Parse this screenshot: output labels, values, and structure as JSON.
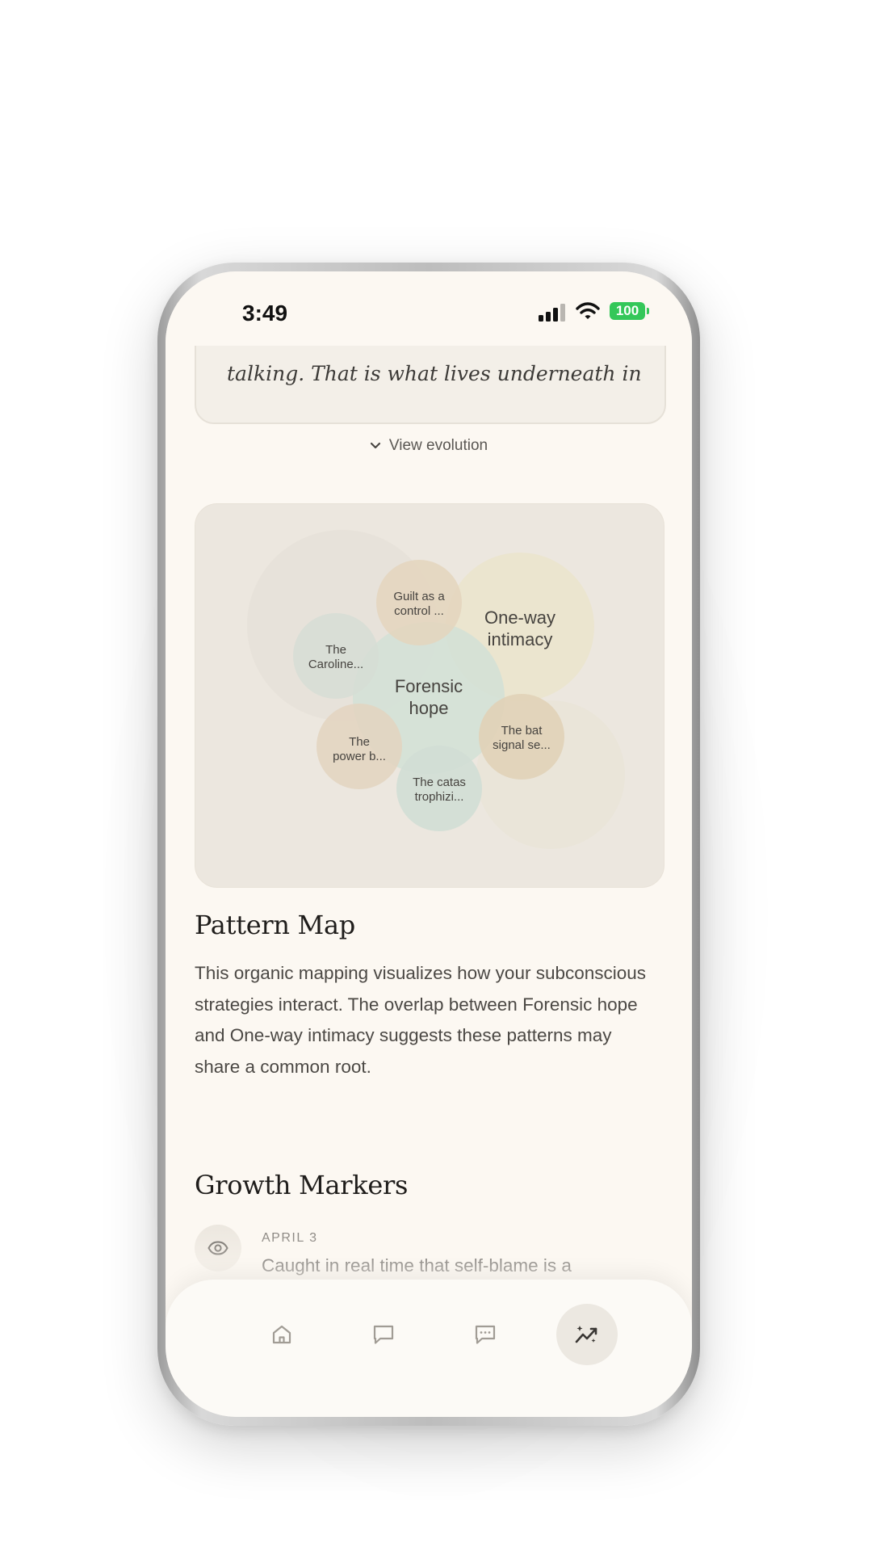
{
  "status_bar": {
    "time": "3:49",
    "battery": "100"
  },
  "insight": {
    "quote_partial": "talking. That is what lives underneath in",
    "view_evolution_label": "View evolution"
  },
  "pattern_map": {
    "bubbles": [
      {
        "id": "forensic-hope",
        "lines": [
          "Forensic",
          "hope"
        ],
        "color": "#cfe0d6",
        "primary": true
      },
      {
        "id": "one-way-intimacy",
        "lines": [
          "One-way",
          "intimacy"
        ],
        "color": "#ebe3c9",
        "primary": true
      },
      {
        "id": "guilt-as-a-control",
        "lines": [
          "Guilt as a",
          "control ..."
        ],
        "color": "#e6d7c0"
      },
      {
        "id": "the-caroline",
        "lines": [
          "The",
          "Caroline..."
        ],
        "color": "#d9dfd8"
      },
      {
        "id": "the-power-b",
        "lines": [
          "The",
          "power b..."
        ],
        "color": "#e6d8c6"
      },
      {
        "id": "the-bat-signal",
        "lines": [
          "The bat",
          "signal se..."
        ],
        "color": "#e3d5bb"
      },
      {
        "id": "the-catastrophizing",
        "lines": [
          "The catas",
          "trophizi..."
        ],
        "color": "#d4e0d7"
      }
    ],
    "title": "Pattern Map",
    "description": "This organic mapping visualizes how your subconscious strategies interact. The overlap between Forensic hope and One-way intimacy suggests these patterns may share a common root."
  },
  "growth_markers": {
    "title": "Growth Markers",
    "items": [
      {
        "date": "APRIL 3",
        "text": "Caught in real time that self-blame is a",
        "icon": "eye-icon"
      }
    ]
  },
  "nav": {
    "items": [
      {
        "name": "home",
        "icon": "home-icon",
        "active": false
      },
      {
        "name": "chat",
        "icon": "chat-bubble-icon",
        "active": false
      },
      {
        "name": "messages",
        "icon": "chat-dots-icon",
        "active": false
      },
      {
        "name": "insights",
        "icon": "insights-sparkle-icon",
        "active": true
      }
    ]
  },
  "colors": {
    "background": "#fcf8f2",
    "card": "#ece7df",
    "text_primary": "#1f1d1b",
    "text_secondary": "#4b4844",
    "battery": "#34c759"
  }
}
